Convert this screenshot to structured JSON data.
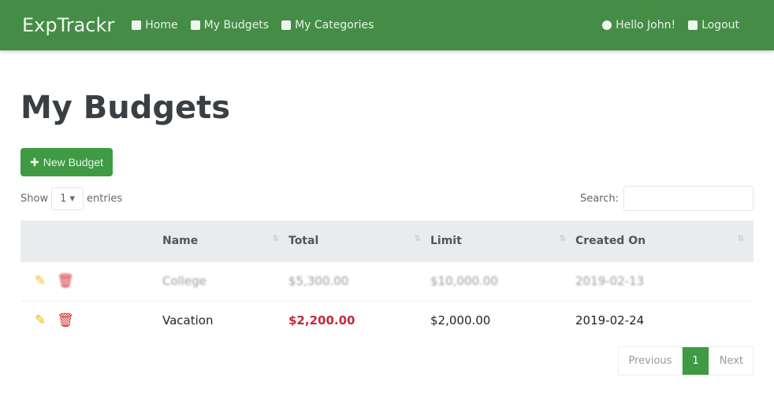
{
  "nav": {
    "brand": "ExpTrackr",
    "links": [
      "Home",
      "My Budgets",
      "My Categories"
    ],
    "greeting": "Hello John!",
    "logout": "Logout"
  },
  "page": {
    "title": "My Budgets",
    "new_button": "New Budget"
  },
  "controls": {
    "show": "Show",
    "entries_value": "1",
    "entries": "entries",
    "search": "Search:",
    "search_value": ""
  },
  "table": {
    "headers": [
      "",
      "Name",
      "Total",
      "Limit",
      "Created On"
    ],
    "rows": [
      {
        "name": "College",
        "total": "$5,300.00",
        "limit": "$10,000.00",
        "created": "2019-02-13"
      },
      {
        "name": "Vacation",
        "total": "$2,200.00",
        "limit": "$2,000.00",
        "created": "2019-02-24"
      }
    ]
  },
  "pagination": {
    "previous": "Previous",
    "current": "1",
    "next": "Next"
  },
  "colors": {
    "nav": "#458d47",
    "accent": "#3f9a44",
    "over_limit": "#c8283a",
    "edit": "#f0b400",
    "delete": "#d32f2f"
  }
}
